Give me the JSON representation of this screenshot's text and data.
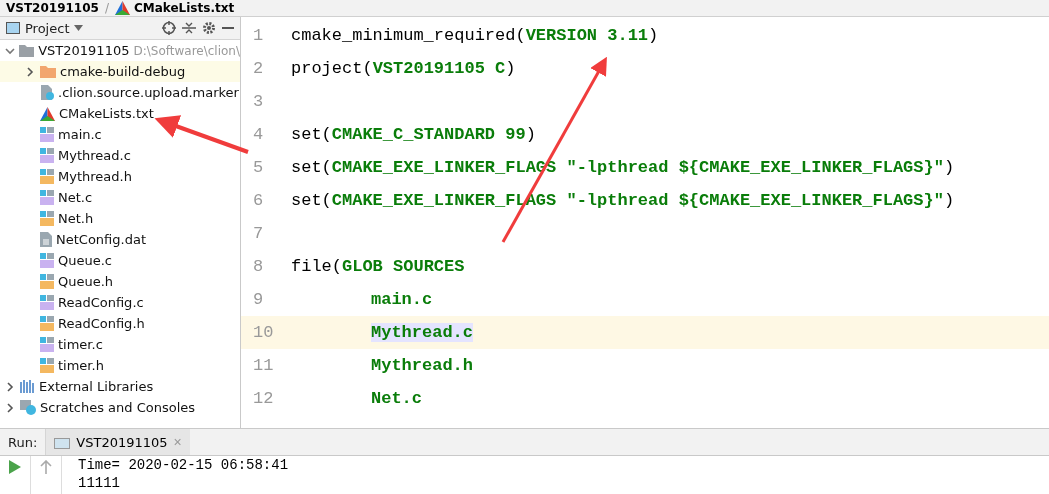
{
  "breadcrumb_separator": "/",
  "breadcrumb": [
    {
      "label": "VST20191105",
      "kind": "project"
    },
    {
      "label": "CMakeLists.txt",
      "kind": "cmake"
    }
  ],
  "project_panel": {
    "title": "Project",
    "tree": [
      {
        "label": "VST20191105",
        "path": "D:\\Software\\clion\\",
        "kind": "root",
        "expanded": true,
        "selected": false,
        "children": [
          {
            "label": "cmake-build-debug",
            "kind": "folder",
            "expanded": false,
            "selected": true
          },
          {
            "label": ".clion.source.upload.marker",
            "kind": "unknown",
            "selected": false
          },
          {
            "label": "CMakeLists.txt",
            "kind": "cmake",
            "selected": false
          },
          {
            "label": "main.c",
            "kind": "c",
            "selected": false
          },
          {
            "label": "Mythread.c",
            "kind": "c",
            "selected": false
          },
          {
            "label": "Mythread.h",
            "kind": "h",
            "selected": false
          },
          {
            "label": "Net.c",
            "kind": "c",
            "selected": false
          },
          {
            "label": "Net.h",
            "kind": "h",
            "selected": false
          },
          {
            "label": "NetConfig.dat",
            "kind": "text",
            "selected": false
          },
          {
            "label": "Queue.c",
            "kind": "c",
            "selected": false
          },
          {
            "label": "Queue.h",
            "kind": "h",
            "selected": false
          },
          {
            "label": "ReadConfig.c",
            "kind": "c",
            "selected": false
          },
          {
            "label": "ReadConfig.h",
            "kind": "h",
            "selected": false
          },
          {
            "label": "timer.c",
            "kind": "c",
            "selected": false
          },
          {
            "label": "timer.h",
            "kind": "h",
            "selected": false
          }
        ]
      },
      {
        "label": "External Libraries",
        "kind": "library",
        "expanded": false,
        "selected": false
      },
      {
        "label": "Scratches and Consoles",
        "kind": "scratch",
        "expanded": false,
        "selected": false
      }
    ]
  },
  "editor": {
    "lines": [
      {
        "number": "1",
        "current": false,
        "indented": false,
        "tokens": [
          {
            "text": "cmake_minimum_required(",
            "kind": "plain",
            "highlighted": false
          },
          {
            "text": "VERSION 3.11",
            "kind": "arg",
            "highlighted": false
          },
          {
            "text": ")",
            "kind": "plain",
            "highlighted": false
          }
        ]
      },
      {
        "number": "2",
        "current": false,
        "indented": false,
        "tokens": [
          {
            "text": "project(",
            "kind": "plain",
            "highlighted": false
          },
          {
            "text": "VST20191105 C",
            "kind": "arg",
            "highlighted": false
          },
          {
            "text": ")",
            "kind": "plain",
            "highlighted": false
          }
        ]
      },
      {
        "number": "3",
        "current": false
      },
      {
        "number": "4",
        "current": false,
        "indented": false,
        "tokens": [
          {
            "text": "set(",
            "kind": "plain",
            "highlighted": false
          },
          {
            "text": "CMAKE_C_STANDARD 99",
            "kind": "arg",
            "highlighted": false
          },
          {
            "text": ")",
            "kind": "plain",
            "highlighted": false
          }
        ]
      },
      {
        "number": "5",
        "current": false,
        "indented": false,
        "tokens": [
          {
            "text": "set(",
            "kind": "plain",
            "highlighted": false
          },
          {
            "text": "CMAKE_EXE_LINKER_FLAGS \"-lpthread ${CMAKE_EXE_LINKER_FLAGS}\"",
            "kind": "arg",
            "highlighted": false
          },
          {
            "text": ")",
            "kind": "plain",
            "highlighted": false
          }
        ]
      },
      {
        "number": "6",
        "current": false,
        "indented": false,
        "tokens": [
          {
            "text": "set(",
            "kind": "plain",
            "highlighted": false
          },
          {
            "text": "CMAKE_EXE_LINKER_FLAGS \"-lpthread ${CMAKE_EXE_LINKER_FLAGS}\"",
            "kind": "arg",
            "highlighted": false
          },
          {
            "text": ")",
            "kind": "plain",
            "highlighted": false
          }
        ]
      },
      {
        "number": "7",
        "current": false
      },
      {
        "number": "8",
        "current": false,
        "indented": false,
        "tokens": [
          {
            "text": "file(",
            "kind": "plain",
            "highlighted": false
          },
          {
            "text": "GLOB SOURCES",
            "kind": "arg",
            "highlighted": false
          }
        ]
      },
      {
        "number": "9",
        "current": false,
        "indented": true,
        "tokens": [
          {
            "text": "main.c",
            "kind": "arg",
            "highlighted": false
          }
        ]
      },
      {
        "number": "10",
        "current": true,
        "indented": true,
        "tokens": [
          {
            "text": "Mythread.c",
            "kind": "arg",
            "highlighted": true
          }
        ]
      },
      {
        "number": "11",
        "current": false,
        "indented": true,
        "tokens": [
          {
            "text": "Mythread.h",
            "kind": "arg",
            "highlighted": false
          }
        ]
      },
      {
        "number": "12",
        "current": false,
        "indented": true,
        "tokens": [
          {
            "text": "Net.c",
            "kind": "arg",
            "highlighted": false
          }
        ]
      }
    ]
  },
  "run_panel": {
    "label": "Run:",
    "tabs": [
      {
        "label": "VST20191105",
        "close": "×",
        "selected": true
      }
    ],
    "output": [
      "Time= 2020-02-15 06:58:41",
      "11111"
    ]
  }
}
